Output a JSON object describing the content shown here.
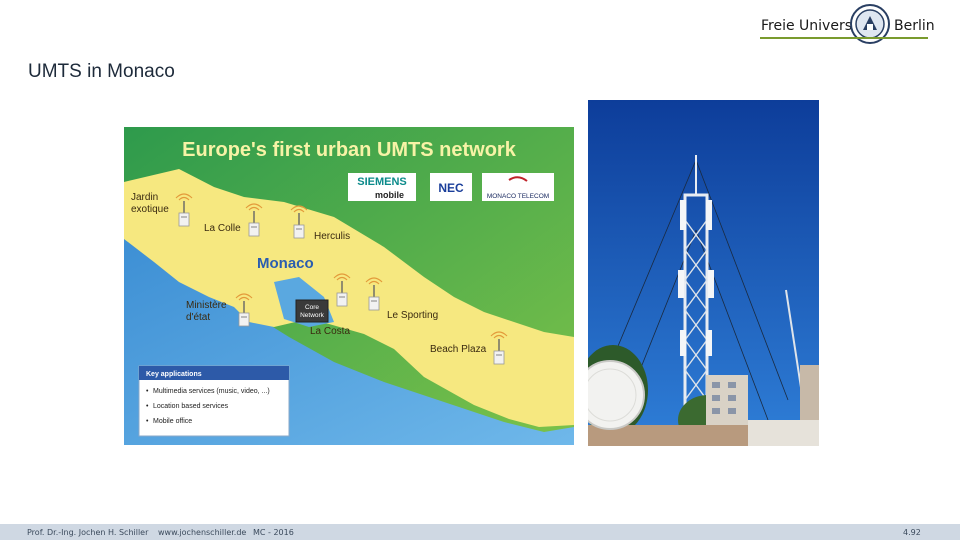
{
  "logo": {
    "left_text": "Freie Universität",
    "right_text": "Berlin"
  },
  "slide_title": "UMTS in Monaco",
  "map": {
    "heading": "Europe's first urban UMTS network",
    "sponsors": [
      "SIEMENS",
      "mobile",
      "NEC",
      "MONACO TELECOM"
    ],
    "places": {
      "jardin1": "Jardin",
      "jardin2": "exotique",
      "la_colle": "La Colle",
      "herculis": "Herculis",
      "monaco": "Monaco",
      "ministere1": "Ministère",
      "ministere2": "d'état",
      "core1": "Core",
      "core2": "Network",
      "la_costa": "La Costa",
      "le_sporting": "Le Sporting",
      "beach_plaza": "Beach Plaza"
    },
    "key_box": {
      "title": "Key applications",
      "items": [
        "Multimedia services (music, video, ...)",
        "Location based services",
        "Mobile office"
      ]
    }
  },
  "footer": {
    "author": "Prof. Dr.-Ing. Jochen H. Schiller",
    "website": "www.jochenschiller.de",
    "course": "MC - 2016",
    "page": "4.92"
  }
}
